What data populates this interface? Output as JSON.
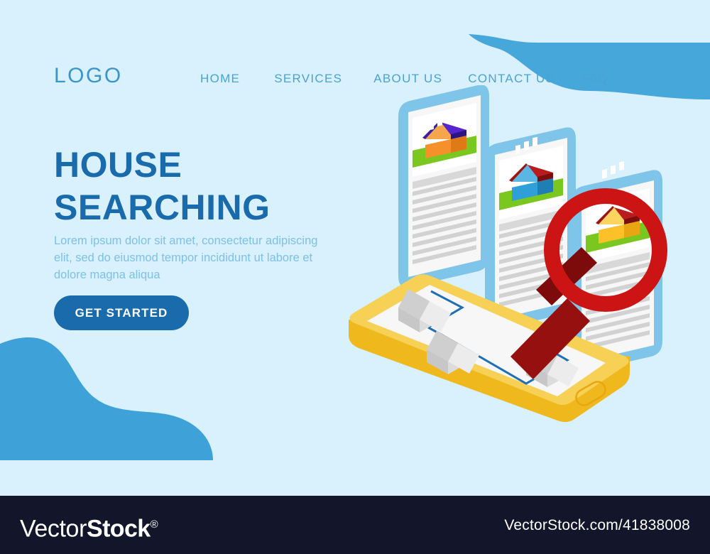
{
  "page": {
    "background_color": "#d9f0fd",
    "accent_blue": "#1a6bab",
    "wave_blue": "#3ea2d8",
    "footer_color": "#13152a"
  },
  "header": {
    "logo": "LOGO",
    "nav": [
      {
        "label": "HOME"
      },
      {
        "label": "SERVICES"
      },
      {
        "label": "ABOUT US"
      },
      {
        "label": "CONTACT US"
      },
      {
        "label": "FAQ"
      }
    ]
  },
  "hero": {
    "headline_line1": "HOUSE",
    "headline_line2": "SEARCHING",
    "paragraph": "Lorem ipsum dolor sit amet, consectetur adipiscing elit, sed do eiusmod tempor incididunt ut labore et dolore magna aliqua",
    "cta_label": "GET STARTED"
  },
  "illustration": {
    "description": "isometric listing cards with houses, magnifying glass and smartphone map",
    "cards": [
      {
        "name": "listing-card-1",
        "house_roof_color": "#3b1fa0",
        "house_body_color": "#f5902b",
        "grass_color": "#7ac720"
      },
      {
        "name": "listing-card-2",
        "house_roof_color": "#9b1515",
        "house_body_color": "#2e9fd8",
        "grass_color": "#7ac720"
      },
      {
        "name": "listing-card-3",
        "house_roof_color": "#9b1515",
        "house_body_color": "#fcc028",
        "grass_color": "#7ac720"
      }
    ],
    "magnifier_color": "#cc1414",
    "magnifier_handle_color": "#96100f",
    "phone_body_color": "#f7d155",
    "phone_screen_color": "#f7f7f7",
    "map_route_color": "#1f6fb2",
    "map_house_color": "#cfcfcf"
  },
  "footer": {
    "brand_thin": "Vector",
    "brand_bold": "Stock",
    "registered_mark": "®",
    "url": "VectorStock.com/41838008"
  }
}
